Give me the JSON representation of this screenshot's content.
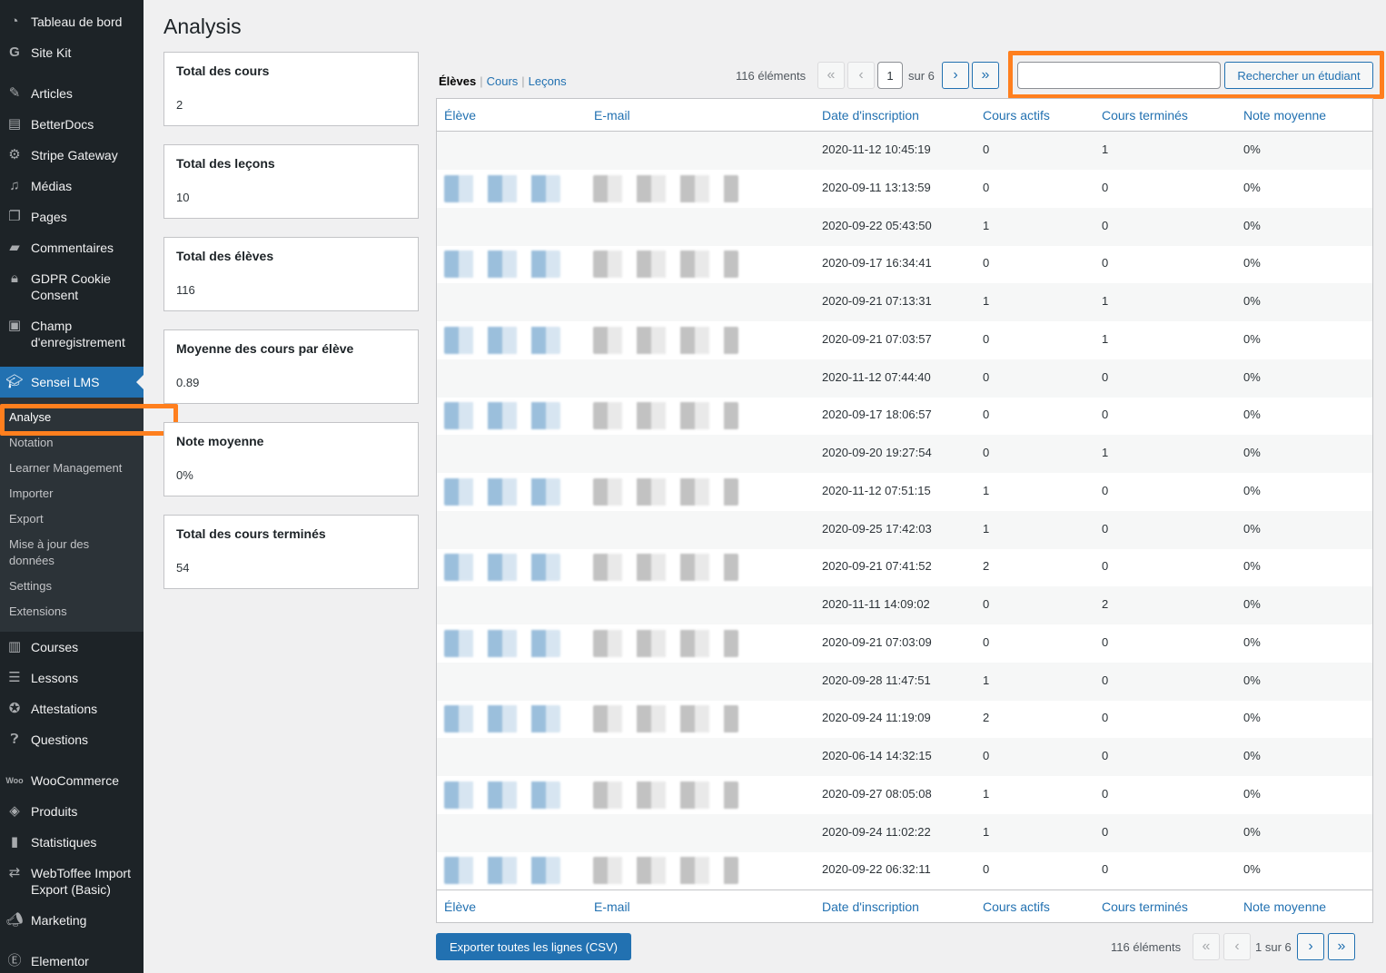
{
  "sidebar": {
    "items": [
      {
        "label": "Tableau de bord",
        "icon": "dashboard-icon"
      },
      {
        "label": "Site Kit",
        "icon": "google-g-icon"
      },
      {
        "label": "Articles",
        "icon": "pin-icon"
      },
      {
        "label": "BetterDocs",
        "icon": "docs-icon"
      },
      {
        "label": "Stripe Gateway",
        "icon": "gear-icon"
      },
      {
        "label": "Médias",
        "icon": "media-icon"
      },
      {
        "label": "Pages",
        "icon": "pages-icon"
      },
      {
        "label": "Commentaires",
        "icon": "comment-icon"
      },
      {
        "label": "GDPR Cookie Consent",
        "icon": "lock-icon"
      },
      {
        "label": "Champ d'enregistrement",
        "icon": "form-icon"
      },
      {
        "label": "Sensei LMS",
        "icon": "graduation-cap-icon"
      }
    ],
    "submenu": [
      "Analyse",
      "Notation",
      "Learner Management",
      "Importer",
      "Export",
      "Mise à jour des données",
      "Settings",
      "Extensions"
    ],
    "items_after": [
      {
        "label": "Courses",
        "icon": "book-icon"
      },
      {
        "label": "Lessons",
        "icon": "list-icon"
      },
      {
        "label": "Attestations",
        "icon": "award-icon"
      },
      {
        "label": "Questions",
        "icon": "question-icon"
      },
      {
        "label": "WooCommerce",
        "icon": "woo-icon"
      },
      {
        "label": "Produits",
        "icon": "box-icon"
      },
      {
        "label": "Statistiques",
        "icon": "bar-chart-icon"
      },
      {
        "label": "WebToffee Import Export (Basic)",
        "icon": "arrows-icon"
      },
      {
        "label": "Marketing",
        "icon": "megaphone-icon"
      },
      {
        "label": "Elementor",
        "icon": "elementor-icon"
      }
    ]
  },
  "page": {
    "title": "Analysis"
  },
  "stats": [
    {
      "title": "Total des cours",
      "value": "2"
    },
    {
      "title": "Total des leçons",
      "value": "10"
    },
    {
      "title": "Total des élèves",
      "value": "116"
    },
    {
      "title": "Moyenne des cours par élève",
      "value": "0.89"
    },
    {
      "title": "Note moyenne",
      "value": "0%"
    },
    {
      "title": "Total des cours terminés",
      "value": "54"
    }
  ],
  "views": {
    "current": "Élèves",
    "links": [
      "Cours",
      "Leçons"
    ]
  },
  "pagination": {
    "count": "116 éléments",
    "first": "«",
    "prev": "‹",
    "next": "›",
    "last": "»",
    "current_page": "1",
    "of_total": "sur 6",
    "bottom_text": "1 sur 6"
  },
  "search": {
    "button_label": "Rechercher un étudiant",
    "value": ""
  },
  "table": {
    "columns": [
      "Élève",
      "E-mail",
      "Date d'inscription",
      "Cours actifs",
      "Cours terminés",
      "Note moyenne"
    ],
    "rows": [
      [
        "2020-11-12 10:45:19",
        "0",
        "1",
        "0%"
      ],
      [
        "2020-09-11 13:13:59",
        "0",
        "0",
        "0%"
      ],
      [
        "2020-09-22 05:43:50",
        "1",
        "0",
        "0%"
      ],
      [
        "2020-09-17 16:34:41",
        "0",
        "0",
        "0%"
      ],
      [
        "2020-09-21 07:13:31",
        "1",
        "1",
        "0%"
      ],
      [
        "2020-09-21 07:03:57",
        "0",
        "1",
        "0%"
      ],
      [
        "2020-11-12 07:44:40",
        "0",
        "0",
        "0%"
      ],
      [
        "2020-09-17 18:06:57",
        "0",
        "0",
        "0%"
      ],
      [
        "2020-09-20 19:27:54",
        "0",
        "1",
        "0%"
      ],
      [
        "2020-11-12 07:51:15",
        "1",
        "0",
        "0%"
      ],
      [
        "2020-09-25 17:42:03",
        "1",
        "0",
        "0%"
      ],
      [
        "2020-09-21 07:41:52",
        "2",
        "0",
        "0%"
      ],
      [
        "2020-11-11 14:09:02",
        "0",
        "2",
        "0%"
      ],
      [
        "2020-09-21 07:03:09",
        "0",
        "0",
        "0%"
      ],
      [
        "2020-09-28 11:47:51",
        "1",
        "0",
        "0%"
      ],
      [
        "2020-09-24 11:19:09",
        "2",
        "0",
        "0%"
      ],
      [
        "2020-06-14 14:32:15",
        "0",
        "0",
        "0%"
      ],
      [
        "2020-09-27 08:05:08",
        "1",
        "0",
        "0%"
      ],
      [
        "2020-09-24 11:02:22",
        "1",
        "0",
        "0%"
      ],
      [
        "2020-09-22 06:32:11",
        "0",
        "0",
        "0%"
      ]
    ]
  },
  "export": {
    "label": "Exporter toutes les lignes (CSV)"
  },
  "colors": {
    "accent": "#2271b1",
    "highlight": "#ff7f1e",
    "sidebar": "#1d2327"
  }
}
